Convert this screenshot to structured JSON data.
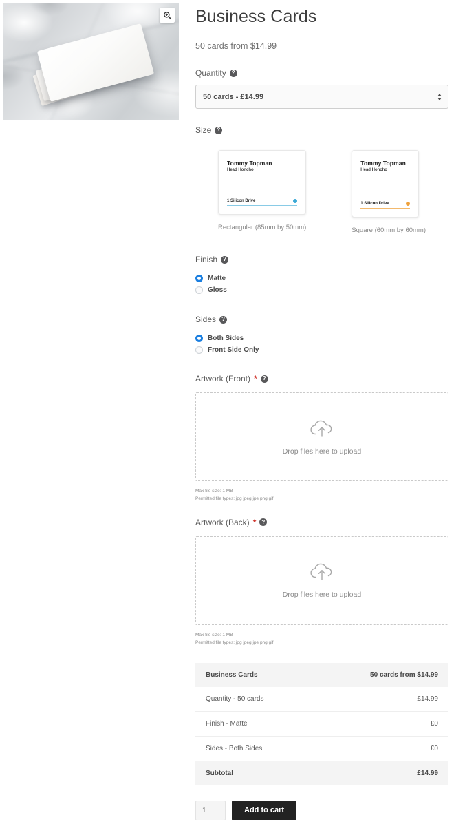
{
  "gallery": {
    "photo_alt": "Stack of white business cards on grey marble surface",
    "zoom_icon": "magnifier-plus-icon"
  },
  "product": {
    "title": "Business Cards",
    "price_from": "50 cards from $14.99"
  },
  "quantity_field": {
    "label": "Quantity",
    "help_icon": "?",
    "selected": "50 cards - £14.99"
  },
  "size_field": {
    "label": "Size",
    "help_icon": "?",
    "options": [
      {
        "caption": "Rectangular (85mm by 50mm)",
        "name": "Tommy Topman",
        "role": "Head Honcho",
        "address": "1 Silicon Drive",
        "accent": "#3ba9d6"
      },
      {
        "caption": "Square (60mm by 60mm)",
        "name": "Tommy Topman",
        "role": "Head Honcho",
        "address": "1 Silicon Drive",
        "accent": "#efa13c"
      }
    ]
  },
  "finish_field": {
    "label": "Finish",
    "help_icon": "?",
    "options": [
      {
        "label": "Matte",
        "selected": true
      },
      {
        "label": "Gloss",
        "selected": false
      }
    ]
  },
  "sides_field": {
    "label": "Sides",
    "help_icon": "?",
    "options": [
      {
        "label": "Both Sides",
        "selected": true
      },
      {
        "label": "Front Side Only",
        "selected": false
      }
    ]
  },
  "artwork_front": {
    "label": "Artwork (Front)",
    "required_mark": "*",
    "help_icon": "?",
    "dropzone_text": "Drop files here to upload",
    "upload_icon": "cloud-upload-icon",
    "max_size_note": "Max file size: 1 MB",
    "file_types_note": "Permitted file types: jpg jpeg jpe png gif"
  },
  "artwork_back": {
    "label": "Artwork (Back)",
    "required_mark": "*",
    "help_icon": "?",
    "dropzone_text": "Drop files here to upload",
    "upload_icon": "cloud-upload-icon",
    "max_size_note": "Max file size: 1 MB",
    "file_types_note": "Permitted file types: jpg jpeg jpe png gif"
  },
  "summary": {
    "header": {
      "label": "Business Cards",
      "value": "50 cards from $14.99"
    },
    "rows": [
      {
        "label": "Quantity - 50 cards",
        "value": "£14.99"
      },
      {
        "label": "Finish - Matte",
        "value": "£0"
      },
      {
        "label": "Sides - Both Sides",
        "value": "£0"
      }
    ],
    "total": {
      "label": "Subtotal",
      "value": "£14.99"
    }
  },
  "cart": {
    "quantity_value": "1",
    "add_button": "Add to cart"
  },
  "colors": {
    "accent_blue": "#1b7fe0",
    "card_blue": "#3ba9d6",
    "card_orange": "#efa13c",
    "button_dark": "#222222",
    "required_red": "#d0342c"
  }
}
